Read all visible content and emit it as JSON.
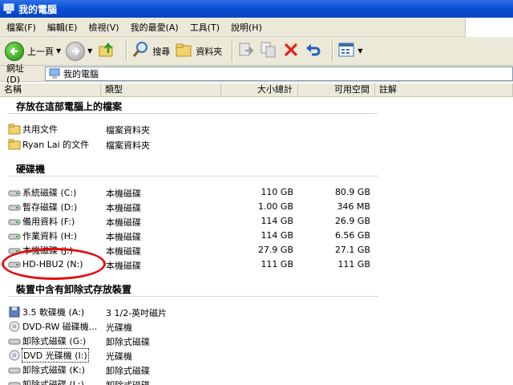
{
  "window": {
    "title": "我的電腦"
  },
  "menu": [
    "檔案(F)",
    "編輯(E)",
    "檢視(V)",
    "我的最愛(A)",
    "工具(T)",
    "說明(H)"
  ],
  "toolbar": {
    "back_label": "上一頁",
    "search_label": "搜尋",
    "folders_label": "資料夾"
  },
  "address": {
    "label": "網址(D)",
    "value": "我的電腦"
  },
  "columns": {
    "name": "名稱",
    "type": "類型",
    "total": "大小總計",
    "free": "可用空間",
    "comment": "註解"
  },
  "groups": {
    "files": "存放在這部電腦上的檔案",
    "hdd": "硬碟機",
    "removable": "裝置中含有卸除式存放裝置"
  },
  "files": [
    {
      "name": "共用文件",
      "type": "檔案資料夾"
    },
    {
      "name": "Ryan Lai 的文件",
      "type": "檔案資料夾"
    }
  ],
  "drives": [
    {
      "name": "系統磁碟 (C:)",
      "type": "本機磁碟",
      "total": "110 GB",
      "free": "80.9 GB"
    },
    {
      "name": "暫存磁碟 (D:)",
      "type": "本機磁碟",
      "total": "1.00 GB",
      "free": "346 MB"
    },
    {
      "name": "備用資料 (F:)",
      "type": "本機磁碟",
      "total": "114 GB",
      "free": "26.9 GB"
    },
    {
      "name": "作業資料 (H:)",
      "type": "本機磁碟",
      "total": "114 GB",
      "free": "6.56 GB"
    },
    {
      "name": "本機磁碟 (J:)",
      "type": "本機磁碟",
      "total": "27.9 GB",
      "free": "27.1 GB"
    },
    {
      "name": "HD-HBU2 (N:)",
      "type": "本機磁碟",
      "total": "111 GB",
      "free": "111 GB"
    }
  ],
  "removable": [
    {
      "name": "3.5 軟碟機 (A:)",
      "type": "3 1/2-英吋磁片"
    },
    {
      "name": "DVD-RW 磁碟機...",
      "type": "光碟機"
    },
    {
      "name": "卸除式磁碟 (G:)",
      "type": "卸除式磁碟"
    },
    {
      "name": "DVD 光碟機 (I:)",
      "type": "光碟機"
    },
    {
      "name": "卸除式磁碟 (K:)",
      "type": "卸除式磁碟"
    },
    {
      "name": "卸除式磁碟 (L:)",
      "type": "卸除式磁碟"
    }
  ]
}
